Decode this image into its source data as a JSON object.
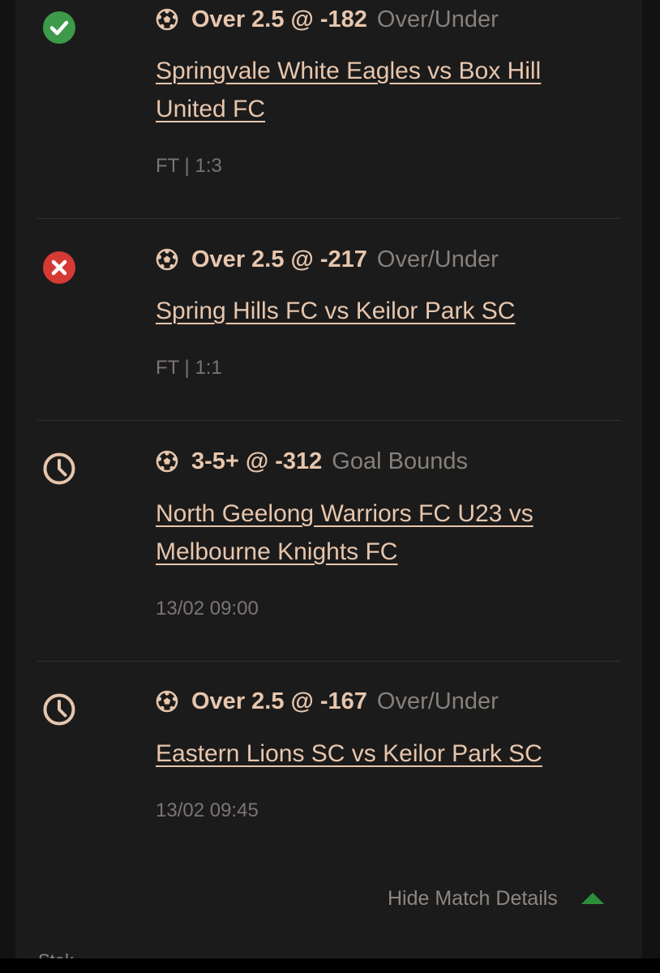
{
  "picks": [
    {
      "status": "won",
      "status_icon": "check-circle-icon",
      "status_color": "#3d9a4a",
      "sport_icon": "soccer-ball-icon",
      "pick": "Over 2.5 @ -182",
      "market": "Over/Under",
      "match": "Springvale White Eagles vs Box Hill United FC",
      "meta": "FT | 1:3"
    },
    {
      "status": "lost",
      "status_icon": "x-circle-icon",
      "status_color": "#d63a34",
      "sport_icon": "soccer-ball-icon",
      "pick": "Over 2.5 @ -217",
      "market": "Over/Under",
      "match": "Spring Hills FC vs Keilor Park SC",
      "meta": "FT | 1:1"
    },
    {
      "status": "pending",
      "status_icon": "clock-icon",
      "status_color": "#e6c6ad",
      "sport_icon": "soccer-ball-icon",
      "pick": "3-5+ @ -312",
      "market": "Goal Bounds",
      "match": "North Geelong Warriors FC U23 vs Melbourne Knights FC",
      "meta": "13/02 09:00"
    },
    {
      "status": "pending",
      "status_icon": "clock-icon",
      "status_color": "#e6c6ad",
      "sport_icon": "soccer-ball-icon",
      "pick": "Over 2.5 @ -167",
      "market": "Over/Under",
      "match": "Eastern Lions SC vs Keilor Park SC",
      "meta": "13/02 09:45"
    }
  ],
  "footer": {
    "hide_details_label": "Hide Match Details",
    "toggle_icon": "triangle-up-icon",
    "toggle_color": "#2e8f3a",
    "cut_off_text": "Stak"
  },
  "colors": {
    "accent_text": "#e6c6ad",
    "muted_text": "#86807b",
    "background": "#1c1b1b"
  }
}
